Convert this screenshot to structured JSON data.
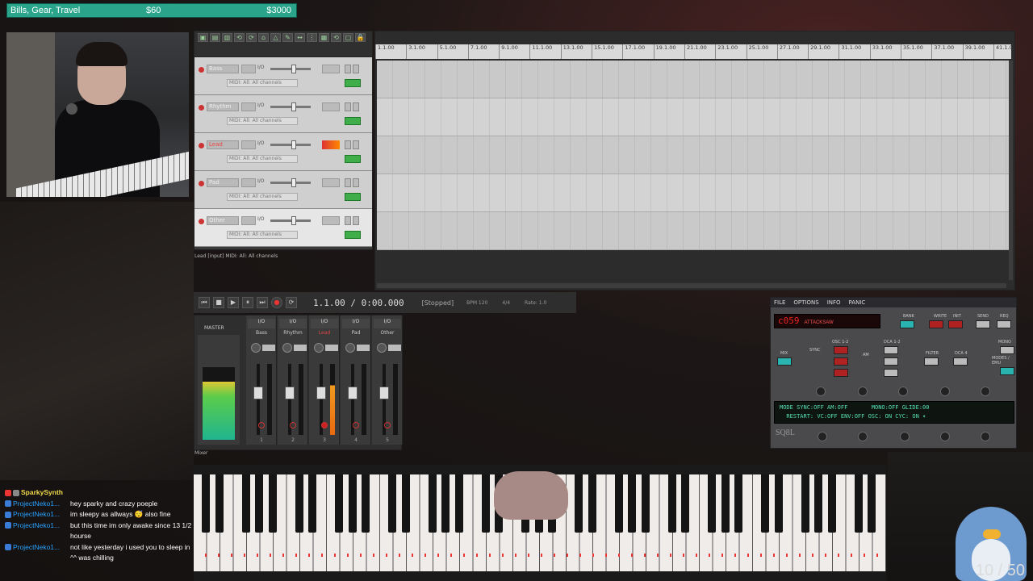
{
  "goal": {
    "label": "Bills, Gear, Travel",
    "current": "$60",
    "total": "$3000"
  },
  "daw": {
    "tracks": [
      {
        "name": "Bass",
        "midi": "MIDI: All: All channels"
      },
      {
        "name": "Rhythm",
        "midi": "MIDI: All: All channels"
      },
      {
        "name": "Lead",
        "midi": "MIDI: All: All channels"
      },
      {
        "name": "Pad",
        "midi": "MIDI: All: All channels"
      },
      {
        "name": "Other",
        "midi": "MIDI: All: All channels"
      }
    ],
    "status_line": "Lead [input] MIDI: All: All channels",
    "ruler": [
      "1.1.00",
      "3.1.00",
      "5.1.00",
      "7.1.00",
      "9.1.00",
      "11.1.00",
      "13.1.00",
      "15.1.00",
      "17.1.00",
      "19.1.00",
      "21.1.00",
      "23.1.00",
      "25.1.00",
      "27.1.00",
      "29.1.00",
      "31.1.00",
      "33.1.00",
      "35.1.00",
      "37.1.00",
      "39.1.00",
      "41.1.00"
    ],
    "transport": {
      "time": "1.1.00 / 0:00.000",
      "state": "[Stopped]",
      "bpm": "BPM 120",
      "sig": "4/4",
      "rate": "Rate: 1.0"
    },
    "mixer": {
      "master": "MASTER",
      "strips": [
        {
          "name": "Bass",
          "num": "1"
        },
        {
          "name": "Rhythm",
          "num": "2"
        },
        {
          "name": "Lead",
          "num": "3"
        },
        {
          "name": "Pad",
          "num": "4"
        },
        {
          "name": "Other",
          "num": "5"
        }
      ],
      "io": "I/O",
      "tab": "Mixer"
    }
  },
  "synth": {
    "menu": [
      "FILE",
      "OPTIONS",
      "INFO",
      "PANIC"
    ],
    "patch_num": "c059",
    "patch_name": "ATTACKSAW",
    "labels": {
      "bank": "BANK",
      "write": "WRITE",
      "init": "INIT",
      "send": "SEND",
      "req": "REQ",
      "mix": "MIX",
      "sync": "SYNC",
      "osc12": "OSC 1-2",
      "dca12": "DCA 1-2",
      "filter": "FILTER",
      "dca4": "DCA 4",
      "am": "AM",
      "mono": "MONO",
      "modes": "MODES / EMU"
    },
    "lcd_line1": "MODE SYNC:OFF AM:OFF       MONO:OFF GLIDE:00",
    "lcd_line2": "  RESTART: VC:OFF ENV:OFF OSC: ON CYC: ON ▾",
    "logo": "SQ8L",
    "accent": "#2ab4b0"
  },
  "chat": [
    {
      "user": "SparkySynth",
      "text": ""
    },
    {
      "user": "ProjectNeko1...",
      "text": "hey sparky and crazy poeple"
    },
    {
      "user": "ProjectNeko1...",
      "text": "im sleepy as allways 😴 also fine"
    },
    {
      "user": "ProjectNeko1...",
      "text": "but this time im only awake since 13 1/2 hourse"
    },
    {
      "user": "ProjectNeko1...",
      "text": "not like yesterday i used you to sleep in ^^ was chilling"
    }
  ],
  "counter": "10 / 50"
}
